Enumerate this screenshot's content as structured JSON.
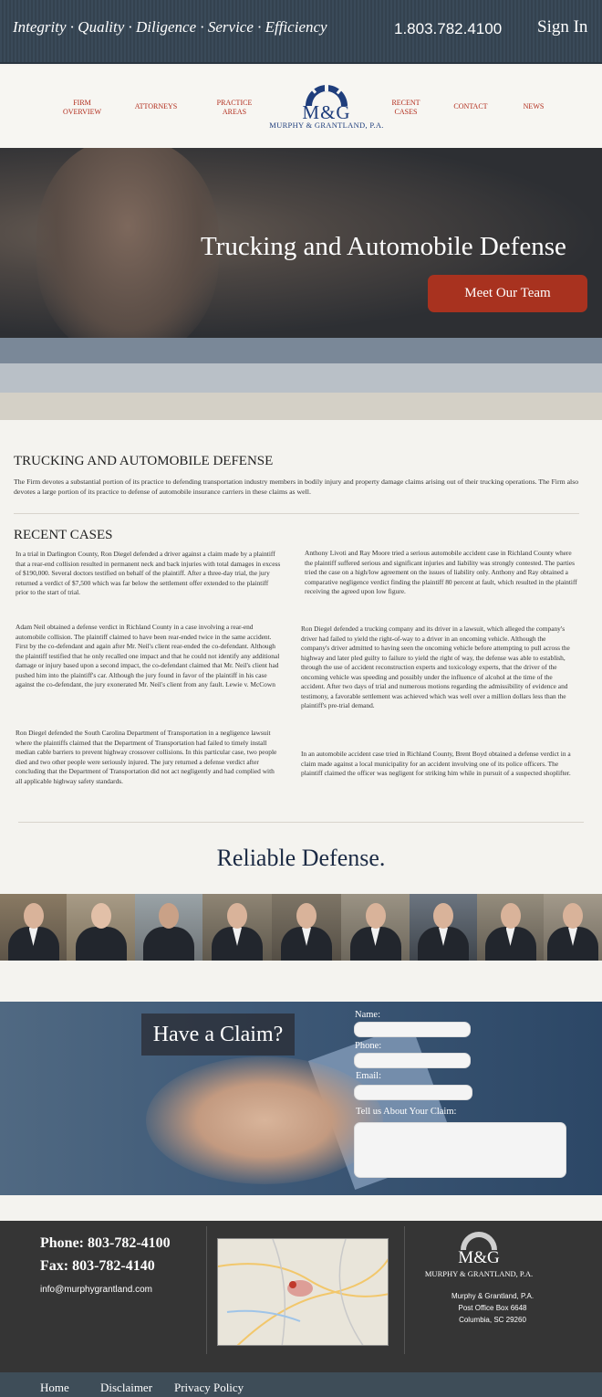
{
  "topbar": {
    "tagline": "Integrity · Quality · Diligence · Service · Efficiency",
    "phone": "1.803.782.4100",
    "signin": "Sign In"
  },
  "nav": {
    "items": [
      {
        "line1": "FIRM",
        "line2": "OVERVIEW"
      },
      {
        "line1": "ATTORNEYS",
        "line2": ""
      },
      {
        "line1": "PRACTICE",
        "line2": "AREAS"
      },
      {
        "line1": "RECENT",
        "line2": "CASES"
      },
      {
        "line1": "CONTACT",
        "line2": ""
      },
      {
        "line1": "NEWS",
        "line2": ""
      }
    ],
    "logo_mark": "M&G",
    "logo_name": "MURPHY & GRANTLAND, P.A."
  },
  "hero": {
    "title": "Trucking and Automobile Defense",
    "button": "Meet Our Team"
  },
  "practice": {
    "heading": "TRUCKING AND AUTOMOBILE DEFENSE",
    "intro": "The Firm devotes a substantial portion of its practice to defending transportation industry members in bodily injury and property damage claims arising out of their trucking operations. The Firm also devotes a large portion of its practice to defense of automobile insurance carriers in these claims as well."
  },
  "recent": {
    "heading": "RECENT CASES",
    "left": [
      "In a trial in Darlington County, Ron Diegel defended a driver against a claim made by a plaintiff that a rear-end collision resulted in permanent neck and back injuries with total damages in excess of $190,000. Several doctors testified on behalf of the plaintiff. After a three-day trial, the jury returned a verdict of $7,500 which was far below the settlement offer extended to the plaintiff prior to the start of trial.",
      "Adam Neil obtained a defense verdict in Richland County in a case involving a rear-end automobile collision. The plaintiff claimed to have been rear-ended twice in the same accident. First by the co-defendant and again after Mr. Neil's client rear-ended the co-defendant. Although the plaintiff testified that he only recalled one impact and that he could not identify any additional damage or injury based upon a second impact, the co-defendant claimed that Mr. Neil's client had pushed him into the plaintiff's car. Although the jury found in favor of the plaintiff in his case against the co-defendant, the jury exonerated Mr. Neil's client from any fault. Lewie v. McCown",
      "Ron Diegel defended the South Carolina Department of Transportation in a negligence lawsuit where the plaintiffs claimed that the Department of Transportation had failed to timely install median cable barriers to prevent highway crossover collisions. In this particular case, two people died and two other people were seriously injured. The jury returned a defense verdict after concluding that the Department of Transportation did not act negligently and had complied with all applicable highway safety standards."
    ],
    "right": [
      "Anthony Livoti and Ray Moore tried a serious automobile accident case in Richland County where the plaintiff suffered serious and significant injuries and liability was strongly contested. The parties tried the case on a high/low agreement on the issues of liability only. Anthony and Ray obtained a comparative negligence verdict finding the plaintiff 80 percent at fault, which resulted in the plaintiff receiving the agreed upon low figure.",
      "Ron Diegel defended a trucking company and its driver in a lawsuit, which alleged the company's driver had failed to yield the right-of-way to a driver in an oncoming vehicle. Although the company's driver admitted to having seen the oncoming vehicle before attempting to pull across the highway and later pled guilty to failure to yield the right of way, the defense was able to establish, through the use of accident reconstruction experts and toxicology experts, that the driver of the oncoming vehicle was speeding and possibly under the influence of alcohol at the time of the accident. After two days of trial and numerous motions regarding the admissibility of evidence and testimony, a favorable settlement was achieved which was well over a million dollars less than the plaintiff's pre-trial demand.",
      "In an automobile accident case tried in Richland County, Brent Boyd obtained a defense verdict in a claim made against a local municipality for an accident involving one of its police officers. The plaintiff claimed the officer was negligent for striking him while in pursuit of a suspected shoplifter."
    ]
  },
  "tagline2": "Reliable Defense.",
  "team_count": 9,
  "claim": {
    "title": "Have a Claim?",
    "name_label": "Name:",
    "phone_label": "Phone:",
    "email_label": "Email:",
    "message_label": "Tell us About Your Claim:"
  },
  "footer": {
    "phone": "Phone:  803-782-4100",
    "fax": "Fax:  803-782-4140",
    "email": "info@murphygrantland.com",
    "logo_mark": "M&G",
    "logo_name": "MURPHY & GRANTLAND, P.A.",
    "address": [
      "Murphy & Grantland, P.A.",
      "Post Office Box 6648",
      "Columbia, SC 29260"
    ]
  },
  "bottom_links": [
    "Home",
    "Disclaimer",
    "Privacy Policy"
  ],
  "colors": {
    "accent_red": "#a8321f",
    "nav_red": "#b12b1b",
    "brand_blue": "#1f3e7c"
  }
}
